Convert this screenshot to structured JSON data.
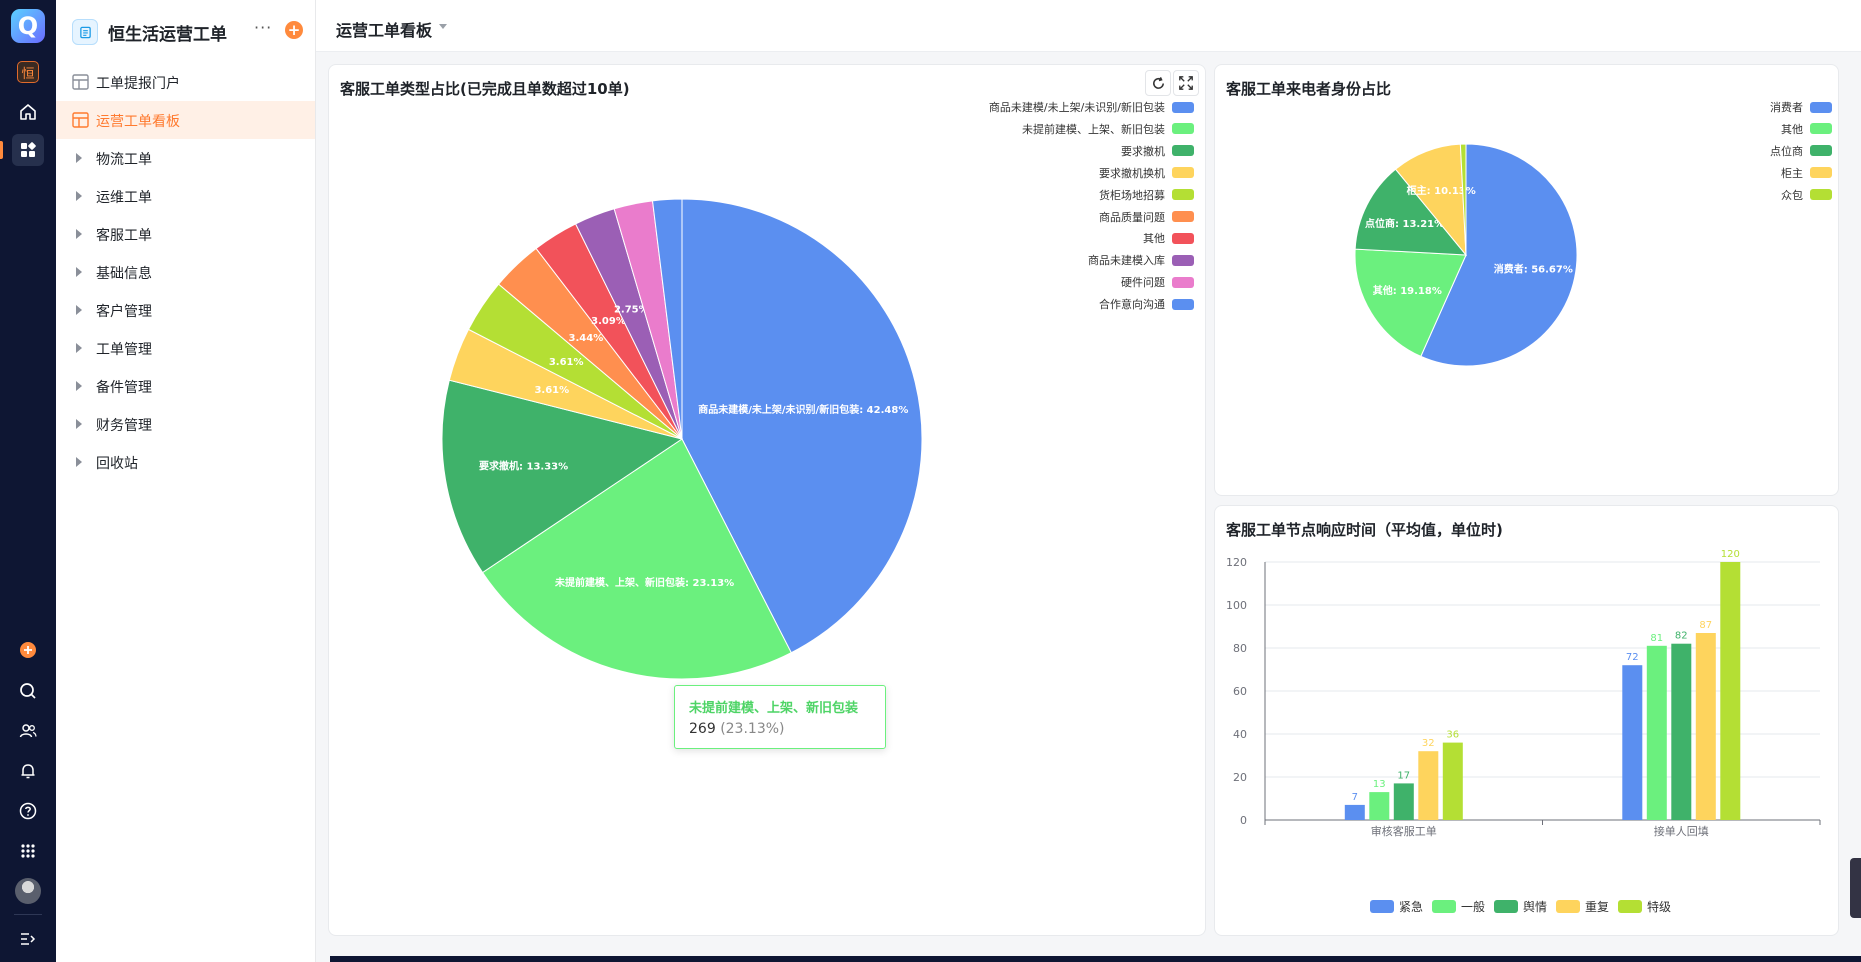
{
  "rail": {
    "logo": "Q",
    "app_chip": "恒",
    "icons": [
      "home-icon",
      "apps-icon",
      "add-icon",
      "search-icon",
      "users-icon",
      "bell-icon",
      "help-icon",
      "grid-icon",
      "avatar",
      "collapse-icon"
    ]
  },
  "sidebar": {
    "app_name": "恒生活运营工单",
    "more": "···",
    "plus": "+",
    "items": [
      {
        "label": "工单提报门户",
        "type": "page",
        "active": false
      },
      {
        "label": "运营工单看板",
        "type": "page",
        "active": true
      },
      {
        "label": "物流工单",
        "type": "group"
      },
      {
        "label": "运维工单",
        "type": "group"
      },
      {
        "label": "客服工单",
        "type": "group"
      },
      {
        "label": "基础信息",
        "type": "group"
      },
      {
        "label": "客户管理",
        "type": "group"
      },
      {
        "label": "工单管理",
        "type": "group"
      },
      {
        "label": "备件管理",
        "type": "group"
      },
      {
        "label": "财务管理",
        "type": "group"
      },
      {
        "label": "回收站",
        "type": "group"
      }
    ]
  },
  "header": {
    "title": "运营工单看板"
  },
  "colors": {
    "accent": "#ff8a3d",
    "palette": [
      "#5b8ff0",
      "#6bf07e",
      "#3fb26a",
      "#fed45d",
      "#b4df34",
      "#ff8f4f",
      "#f2525a",
      "#9b5fb5",
      "#ea7ccc",
      "#5b8ff0"
    ]
  },
  "cards": {
    "type_pie": {
      "title": "客服工单类型占比(已完成且单数超过10单)",
      "tooltip": {
        "name": "未提前建模、上架、新旧包装",
        "value": "269",
        "percent": "(23.13%)"
      }
    },
    "caller_pie": {
      "title": "客服工单来电者身份占比"
    },
    "response_bar": {
      "title": "客服工单节点响应时间（平均值，单位时)"
    }
  },
  "chart_data": [
    {
      "type": "pie",
      "title": "客服工单类型占比(已完成且单数超过10单)",
      "legend_position": "top-right",
      "slices": [
        {
          "name": "商品未建模/未上架/未识别/新旧包装",
          "percent": 42.48,
          "label": "商品未建模/未上架/未识别/新旧包装: 42.48%"
        },
        {
          "name": "未提前建模、上架、新旧包装",
          "percent": 23.13,
          "value": 269,
          "label": "未提前建模、上架、新旧包装: 23.13%"
        },
        {
          "name": "要求撤机",
          "percent": 13.33,
          "label": "要求撤机: 13.33%"
        },
        {
          "name": "要求撤机换机",
          "percent": 3.61,
          "label": "3.61%"
        },
        {
          "name": "货柜场地招募",
          "percent": 3.61,
          "label": "3.61%"
        },
        {
          "name": "商品质量问题",
          "percent": 3.44,
          "label": "3.44%"
        },
        {
          "name": "其他",
          "percent": 3.09,
          "label": "3.09%"
        },
        {
          "name": "商品未建模入库",
          "percent": 2.75,
          "label": "2.75%"
        },
        {
          "name": "硬件问题",
          "percent": 2.6,
          "label": ""
        },
        {
          "name": "合作意向沟通",
          "percent": 1.96,
          "label": ""
        }
      ]
    },
    {
      "type": "pie",
      "title": "客服工单来电者身份占比",
      "legend_position": "top-right",
      "slices": [
        {
          "name": "消费者",
          "percent": 56.67,
          "label": "消费者: 56.67%"
        },
        {
          "name": "其他",
          "percent": 19.18,
          "label": "其他: 19.18%"
        },
        {
          "name": "点位商",
          "percent": 13.21,
          "label": "点位商: 13.21%"
        },
        {
          "name": "柜主",
          "percent": 10.13,
          "label": "柜主: 10.13%"
        },
        {
          "name": "众包",
          "percent": 0.81,
          "label": ""
        }
      ]
    },
    {
      "type": "bar",
      "title": "客服工单节点响应时间（平均值，单位时)",
      "categories": [
        "审核客服工单",
        "接单人回填"
      ],
      "series": [
        {
          "name": "紧急",
          "values": [
            7,
            72
          ]
        },
        {
          "name": "一般",
          "values": [
            13,
            81
          ]
        },
        {
          "name": "舆情",
          "values": [
            17,
            82
          ]
        },
        {
          "name": "重复",
          "values": [
            32,
            87
          ]
        },
        {
          "name": "特级",
          "values": [
            36,
            120
          ]
        }
      ],
      "yticks": [
        0,
        20,
        40,
        60,
        80,
        100,
        120
      ],
      "ylim": [
        0,
        120
      ],
      "grid": true,
      "legend_position": "bottom-center"
    }
  ]
}
